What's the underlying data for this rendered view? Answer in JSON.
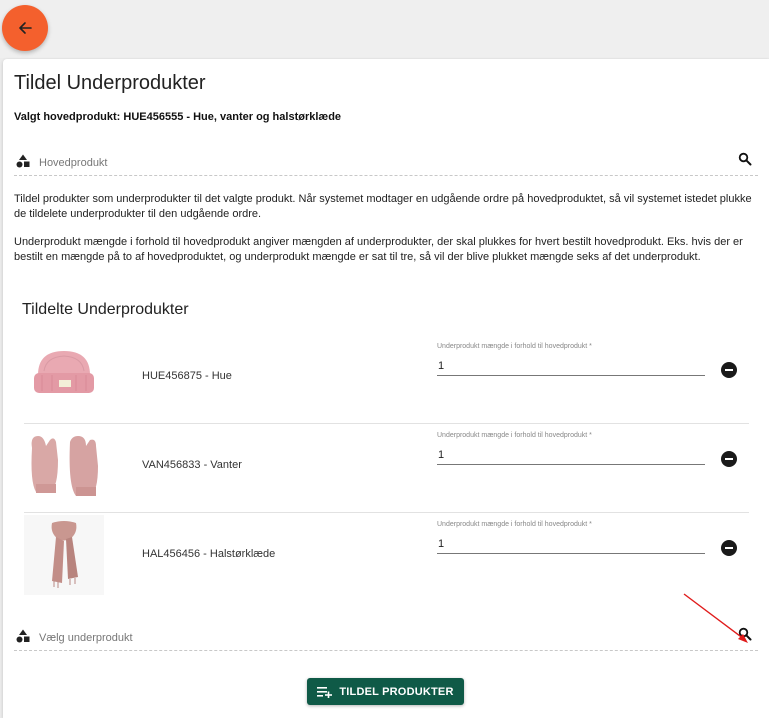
{
  "icons": {
    "back": "arrow-left-icon",
    "lookup": "category-shapes-icon",
    "search": "search-icon",
    "remove": "remove-circle-icon",
    "submit": "playlist-add-icon"
  },
  "colors": {
    "back_fab": "#f4602d",
    "primary": "#0f5a47",
    "annotation_arrow": "#e01b1b"
  },
  "page": {
    "title": "Tildel Underprodukter",
    "selected_main_product": "Valgt hovedprodukt: HUE456555 - Hue, vanter og halstørklæde"
  },
  "main_product_lookup": {
    "placeholder": "Hovedprodukt"
  },
  "description": {
    "paragraph_1": "Tildel produkter som underprodukter til det valgte produkt. Når systemet modtager en udgående ordre på hovedproduktet, så vil systemet istedet plukke de tildelete underprodukter til den udgående ordre.",
    "paragraph_2": "Underprodukt mængde i forhold til hovedprodukt angiver mængden af underprodukter, der skal plukkes for hvert bestilt hovedprodukt. Eks. hvis der er bestilt en mængde på to af hovedproduktet, og underprodukt mængde er sat til tre, så vil der blive plukket mængde seks af det underprodukt."
  },
  "assigned": {
    "heading": "Tildelte Underprodukter",
    "items": [
      {
        "sku": "HUE456875 - Hue",
        "qty_label": "Underprodukt mængde i forhold til hovedprodukt *",
        "qty": "1",
        "image": "pink-knit-beanie"
      },
      {
        "sku": "VAN456833 - Vanter",
        "qty_label": "Underprodukt mængde i forhold til hovedprodukt *",
        "qty": "1",
        "image": "pink-knit-mittens"
      },
      {
        "sku": "HAL456456 - Halstørklæde",
        "qty_label": "Underprodukt mængde i forhold til hovedprodukt *",
        "qty": "1",
        "image": "pink-scarf"
      }
    ]
  },
  "sub_product_lookup": {
    "placeholder": "Vælg underprodukt"
  },
  "actions": {
    "submit_label": "TILDEL PRODUKTER"
  }
}
